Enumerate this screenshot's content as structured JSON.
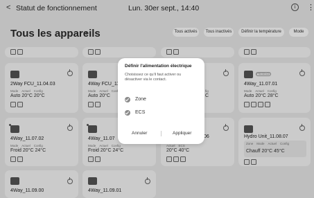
{
  "header": {
    "back_glyph": "<",
    "title": "Statut de fonctionnement",
    "datetime": "Lun. 30er sept., 14:40",
    "info_glyph": "i",
    "more_glyph": "⋮"
  },
  "page": {
    "title": "Tous les appareils",
    "caret": "▾"
  },
  "filters": [
    "Tous activés",
    "Tous inactivés",
    "Définir la température",
    "Mode"
  ],
  "cards": [
    {
      "name": "2Way FCU_11.04.03",
      "labels": [
        "Mode",
        "Actuel",
        "Config"
      ],
      "values": "Auto  20°C  20°C"
    },
    {
      "name": "4Way FCU_11",
      "labels": [
        "Mode",
        "Actuel",
        "Config"
      ],
      "values": "Auto  20°C"
    },
    {
      "name": "",
      "labels": [
        "fig"
      ],
      "values": "C"
    },
    {
      "name": "4Way_11.07.01",
      "badge": "PRESENCE",
      "labels": [
        "Mode",
        "Actuel",
        "Config"
      ],
      "values": "Auto  20°C  28°C"
    },
    {
      "name": "4Way_11.07.02",
      "labels": [
        "Mode",
        "Actuel",
        "Config"
      ],
      "values": "Froid  20°C  24°C"
    },
    {
      "name": "4Way_11.07",
      "labels": [
        "Mode",
        "Actuel",
        "Config"
      ],
      "values": "Froid  20°C  24°C"
    },
    {
      "name": ".06",
      "labels": [
        "Actuel",
        "ECS"
      ],
      "values": "20°C  40°C"
    },
    {
      "name": "Hydro Unit_11.08.07",
      "labels": [
        "Zone",
        "Mode",
        "Actuel",
        "Config"
      ],
      "values": "Chauff  20°C  45°C"
    },
    {
      "name": "4Way_11.09.00"
    },
    {
      "name": "4Way_11.09.01"
    }
  ],
  "dialog": {
    "title": "Définir l'alimentation électrique",
    "description": "Choisissez ce qu'il faut activer ou désactiver via le contact.",
    "options": [
      "Zone",
      "ECS"
    ],
    "cancel": "Annuler",
    "apply": "Appliquer"
  }
}
